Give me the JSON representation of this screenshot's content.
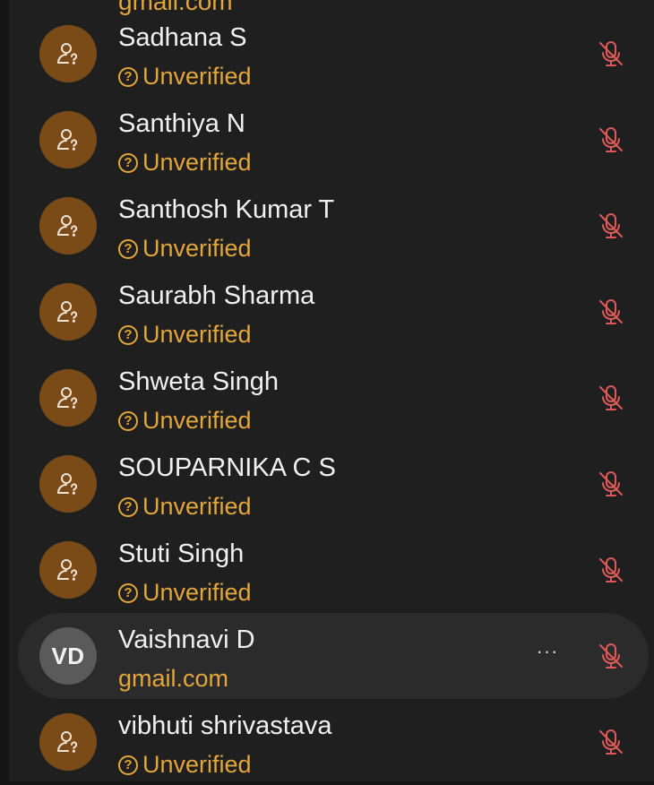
{
  "top_partial_text": "gmail.com",
  "participants": [
    {
      "name": "Sadhana S",
      "status": "Unverified",
      "avatar": "user-question-icon",
      "muted": true
    },
    {
      "name": "Santhiya N",
      "status": "Unverified",
      "avatar": "user-question-icon",
      "muted": true
    },
    {
      "name": "Santhosh Kumar T",
      "status": "Unverified",
      "avatar": "user-question-icon",
      "muted": true
    },
    {
      "name": "Saurabh Sharma",
      "status": "Unverified",
      "avatar": "user-question-icon",
      "muted": true
    },
    {
      "name": "Shweta Singh",
      "status": "Unverified",
      "avatar": "user-question-icon",
      "muted": true
    },
    {
      "name": "SOUPARNIKA C S",
      "status": "Unverified",
      "avatar": "user-question-icon",
      "muted": true
    },
    {
      "name": "Stuti Singh",
      "status": "Unverified",
      "avatar": "user-question-icon",
      "muted": true
    },
    {
      "name": "Vaishnavi D",
      "status": "gmail.com",
      "avatar_initials": "VD",
      "more_label": "···",
      "muted": true
    },
    {
      "name": "vibhuti shrivastava",
      "status": "Unverified",
      "avatar": "user-question-icon",
      "muted": true
    }
  ],
  "colors": {
    "background": "#1f1f1f",
    "hover_row": "#2b2b2b",
    "avatar_brown": "#7a4b16",
    "avatar_gray": "#5a5a5a",
    "status_orange": "#e2a63a",
    "muted_red": "#e05a5a",
    "name_text": "#f1f1f1"
  }
}
